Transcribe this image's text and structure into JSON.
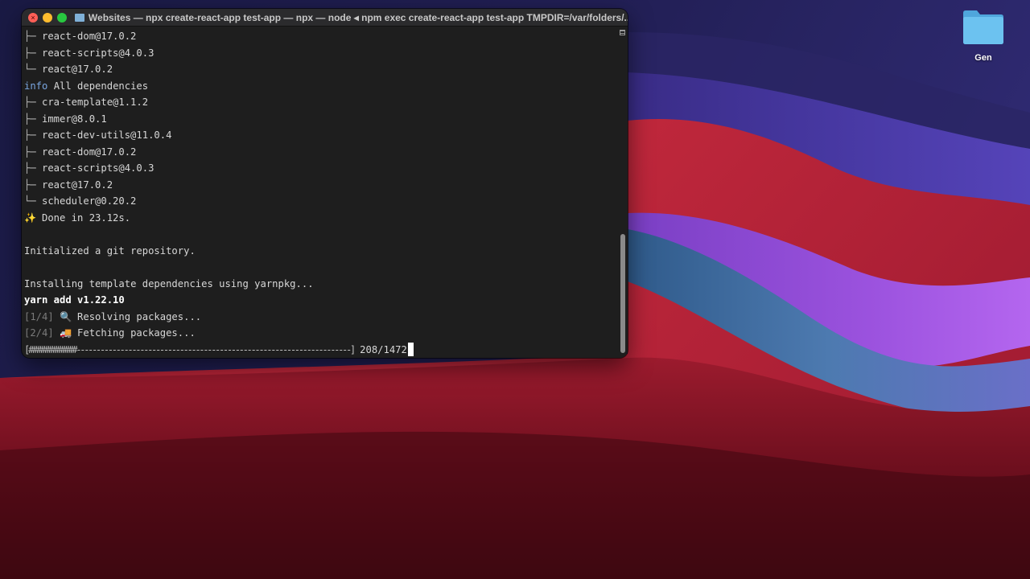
{
  "desktop": {
    "icons": [
      {
        "label": "Gen",
        "icon": "folder-icon"
      }
    ]
  },
  "terminal": {
    "title": "Websites — npx create-react-app test-app — npx — node ◂ npm exec create-react-app test-app TMPDIR=/var/folders/...",
    "lines_top": [
      {
        "glyph": "├─",
        "text": "react-dom@17.0.2"
      },
      {
        "glyph": "├─",
        "text": "react-scripts@4.0.3"
      },
      {
        "glyph": "└─",
        "text": "react@17.0.2"
      }
    ],
    "info_tag": "info",
    "info_text": " All dependencies",
    "dependencies": [
      {
        "glyph": "├─",
        "text": "cra-template@1.1.2"
      },
      {
        "glyph": "├─",
        "text": "immer@8.0.1"
      },
      {
        "glyph": "├─",
        "text": "react-dev-utils@11.0.4"
      },
      {
        "glyph": "├─",
        "text": "react-dom@17.0.2"
      },
      {
        "glyph": "├─",
        "text": "react-scripts@4.0.3"
      },
      {
        "glyph": "├─",
        "text": "react@17.0.2"
      },
      {
        "glyph": "└─",
        "text": "scheduler@0.20.2"
      }
    ],
    "done_emoji": "✨",
    "done_text": "Done in 23.12s.",
    "git_text": "Initialized a git repository.",
    "installing_text": "Installing template dependencies using yarnpkg...",
    "yarn_text": "yarn add v1.22.10",
    "step1_tag": "[1/4]",
    "step1_emoji": "🔍",
    "step1_text": "Resolving packages...",
    "step2_tag": "[2/4]",
    "step2_emoji": "🚚",
    "step2_text": "Fetching packages...",
    "progress_bar": "[############---------------------------------------------------------------------]",
    "progress_count": " 208/1472",
    "progress_fraction": 0.141
  },
  "colors": {
    "terminal_bg": "#1e1e1e",
    "info": "#7aa6e0",
    "close": "#ff5f57",
    "minimize": "#febc2e",
    "zoom": "#28c840"
  }
}
